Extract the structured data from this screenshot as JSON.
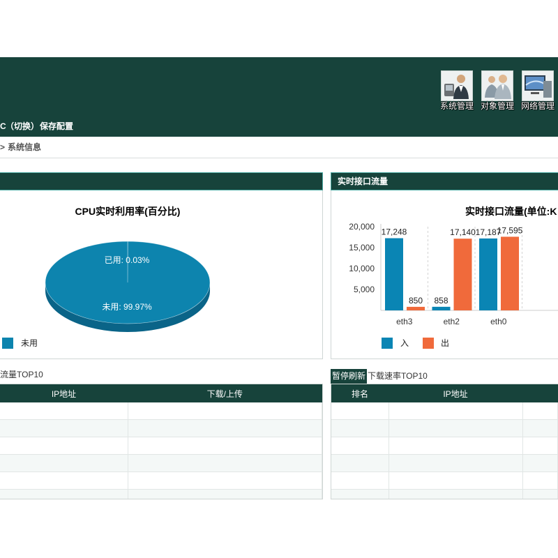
{
  "header": {
    "nav": [
      {
        "label": "系统管理",
        "icon": "system-management-icon"
      },
      {
        "label": "对象管理",
        "icon": "object-management-icon"
      },
      {
        "label": "网络管理",
        "icon": "network-management-icon"
      }
    ],
    "device_name": "C",
    "switch_link": "（切换）",
    "save_config": "保存配置"
  },
  "breadcrumb": {
    "separator": ">",
    "current": "系统信息"
  },
  "traffic_panel": {
    "title": "实时接口流量"
  },
  "top_traffic": {
    "title": "流量TOP10",
    "columns": [
      "IP地址",
      "下载/上传"
    ]
  },
  "top_download": {
    "pause_button": "暂停刷新",
    "title": "下载速率TOP10",
    "columns": [
      "排名",
      "IP地址"
    ]
  },
  "colors": {
    "header_bg": "#17433b",
    "series_in": "#0a85b4",
    "series_out": "#f06a3b",
    "pie_top": "#0d84ae",
    "pie_side": "#0a6488"
  },
  "chart_data": [
    {
      "type": "pie",
      "title": "CPU实时利用率(百分比)",
      "slices": [
        {
          "name": "已用",
          "value": 0.03
        },
        {
          "name": "未用",
          "value": 99.97
        }
      ],
      "unit": "%",
      "legend": [
        "未用"
      ]
    },
    {
      "type": "bar",
      "title": "实时接口流量(单位:K",
      "categories": [
        "eth3",
        "eth2",
        "eth0"
      ],
      "series": [
        {
          "name": "入",
          "values": [
            17248,
            858,
            17187
          ]
        },
        {
          "name": "出",
          "values": [
            850,
            17140,
            17595
          ]
        }
      ],
      "ylim": [
        0,
        20000
      ],
      "yticks": [
        5000,
        10000,
        15000,
        20000
      ],
      "legend_position": "bottom-left"
    }
  ]
}
